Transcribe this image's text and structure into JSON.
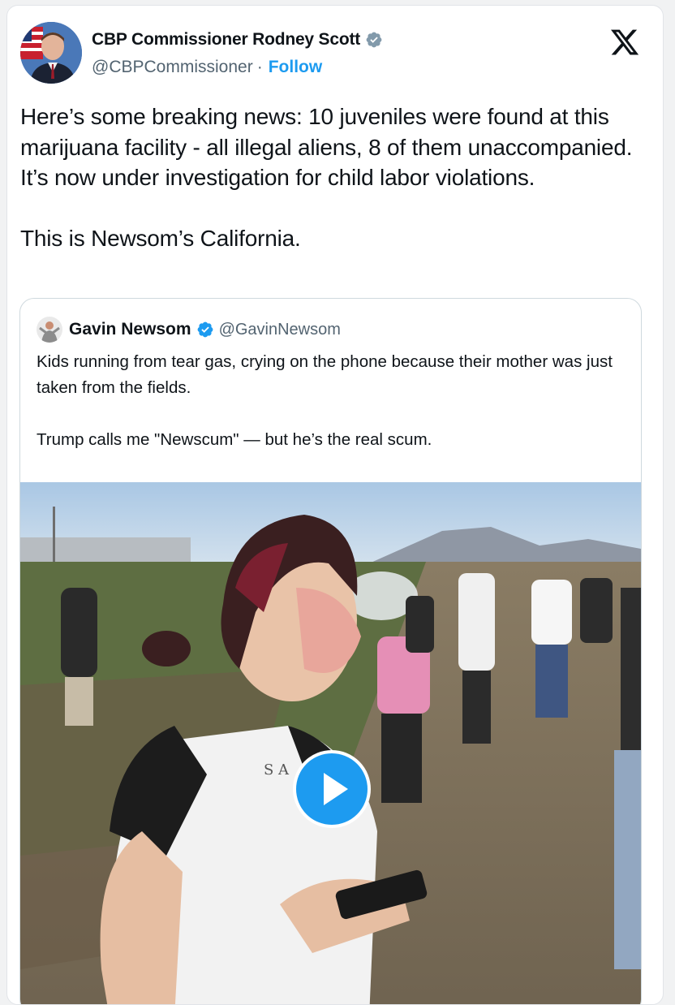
{
  "author": {
    "display_name": "CBP Commissioner Rodney Scott",
    "handle": "@CBPCommissioner",
    "separator": "·",
    "follow_label": "Follow"
  },
  "tweet": {
    "text": "Here’s some breaking news: 10 juveniles were found at this marijuana facility - all illegal aliens, 8 of them unaccompanied. It’s  now under investigation for child labor violations.\n\nThis is Newsom’s California."
  },
  "quoted": {
    "display_name": "Gavin Newsom",
    "handle": "@GavinNewsom",
    "text": "Kids running from tear gas, crying on the phone because their mother was just taken from the fields.\n\nTrump calls me \"Newscum\" — but he’s the real scum."
  },
  "icons": {
    "verified": "verified-badge-icon",
    "platform": "x-logo-icon",
    "play": "play-icon"
  },
  "colors": {
    "accent": "#1d9bf0",
    "verified_gray": "#829aab",
    "text": "#0f1419",
    "muted": "#536471"
  }
}
